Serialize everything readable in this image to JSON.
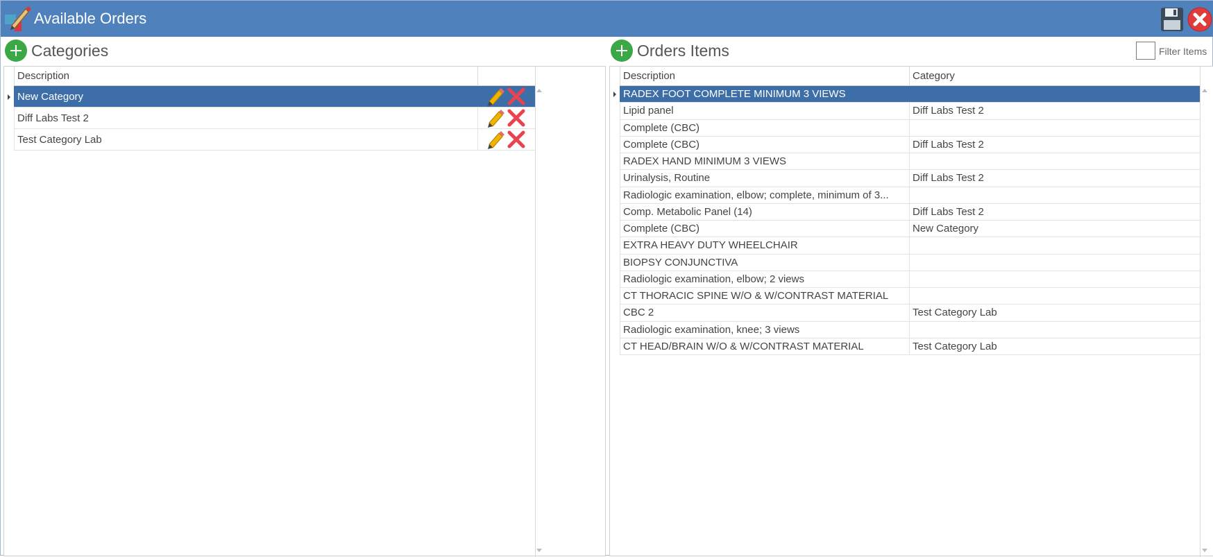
{
  "window": {
    "title": "Available Orders"
  },
  "categories": {
    "title": "Categories",
    "columns": {
      "description": "Description"
    },
    "rows": [
      {
        "description": "New Category",
        "selected": true
      },
      {
        "description": "Diff Labs Test 2",
        "selected": false
      },
      {
        "description": "Test Category Lab",
        "selected": false
      }
    ]
  },
  "orders": {
    "title": "Orders Items",
    "filter_label": "Filter Items",
    "filter_checked": false,
    "columns": {
      "description": "Description",
      "category": "Category"
    },
    "rows": [
      {
        "description": "RADEX FOOT COMPLETE MINIMUM 3 VIEWS",
        "category": "",
        "selected": true
      },
      {
        "description": "Lipid panel",
        "category": "Diff Labs Test 2"
      },
      {
        "description": "Complete (CBC)",
        "category": ""
      },
      {
        "description": "Complete (CBC)",
        "category": "Diff Labs Test 2"
      },
      {
        "description": "RADEX HAND MINIMUM 3 VIEWS",
        "category": ""
      },
      {
        "description": "Urinalysis, Routine",
        "category": "Diff Labs Test 2"
      },
      {
        "description": "Radiologic examination, elbow; complete, minimum of 3...",
        "category": ""
      },
      {
        "description": "Comp. Metabolic Panel (14)",
        "category": "Diff Labs Test 2"
      },
      {
        "description": "Complete (CBC)",
        "category": "New Category"
      },
      {
        "description": "EXTRA HEAVY DUTY WHEELCHAIR",
        "category": ""
      },
      {
        "description": "BIOPSY CONJUNCTIVA",
        "category": ""
      },
      {
        "description": "Radiologic examination, elbow; 2 views",
        "category": ""
      },
      {
        "description": "CT THORACIC SPINE W/O & W/CONTRAST MATERIAL",
        "category": ""
      },
      {
        "description": "CBC 2",
        "category": "Test Category Lab"
      },
      {
        "description": "Radiologic examination, knee; 3 views",
        "category": ""
      },
      {
        "description": "CT HEAD/BRAIN W/O & W/CONTRAST MATERIAL",
        "category": "Test Category Lab"
      }
    ]
  },
  "icons": {
    "app": "orders-app-icon",
    "save": "save-icon",
    "close": "close-icon",
    "add": "plus-icon",
    "edit": "pencil-icon",
    "delete": "delete-x-icon"
  },
  "colors": {
    "titlebar": "#4f81bd",
    "selected_row": "#3e6ea8",
    "add_button": "#3aa845",
    "delete": "#e8434f",
    "edit": "#f0b400"
  }
}
